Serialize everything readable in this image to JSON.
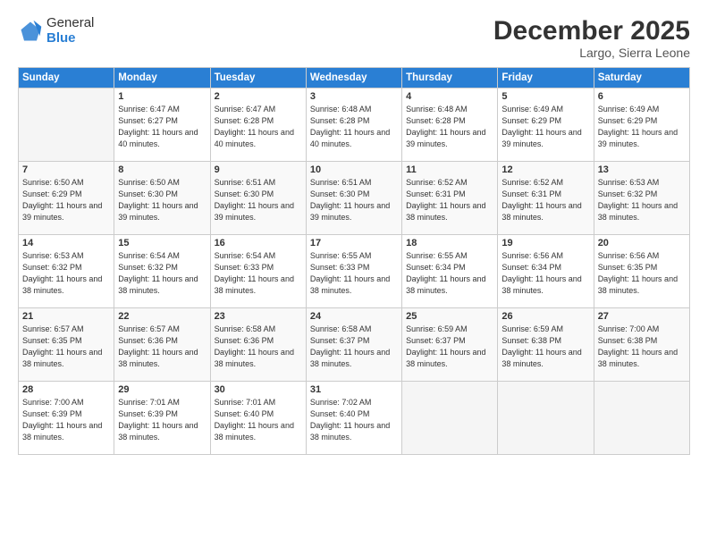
{
  "logo": {
    "general": "General",
    "blue": "Blue"
  },
  "header": {
    "month": "December 2025",
    "location": "Largo, Sierra Leone"
  },
  "weekdays": [
    "Sunday",
    "Monday",
    "Tuesday",
    "Wednesday",
    "Thursday",
    "Friday",
    "Saturday"
  ],
  "weeks": [
    [
      {
        "day": "",
        "empty": true
      },
      {
        "day": "1",
        "sunrise": "6:47 AM",
        "sunset": "6:27 PM",
        "daylight": "11 hours and 40 minutes."
      },
      {
        "day": "2",
        "sunrise": "6:47 AM",
        "sunset": "6:28 PM",
        "daylight": "11 hours and 40 minutes."
      },
      {
        "day": "3",
        "sunrise": "6:48 AM",
        "sunset": "6:28 PM",
        "daylight": "11 hours and 40 minutes."
      },
      {
        "day": "4",
        "sunrise": "6:48 AM",
        "sunset": "6:28 PM",
        "daylight": "11 hours and 39 minutes."
      },
      {
        "day": "5",
        "sunrise": "6:49 AM",
        "sunset": "6:29 PM",
        "daylight": "11 hours and 39 minutes."
      },
      {
        "day": "6",
        "sunrise": "6:49 AM",
        "sunset": "6:29 PM",
        "daylight": "11 hours and 39 minutes."
      }
    ],
    [
      {
        "day": "7",
        "sunrise": "6:50 AM",
        "sunset": "6:29 PM",
        "daylight": "11 hours and 39 minutes."
      },
      {
        "day": "8",
        "sunrise": "6:50 AM",
        "sunset": "6:30 PM",
        "daylight": "11 hours and 39 minutes."
      },
      {
        "day": "9",
        "sunrise": "6:51 AM",
        "sunset": "6:30 PM",
        "daylight": "11 hours and 39 minutes."
      },
      {
        "day": "10",
        "sunrise": "6:51 AM",
        "sunset": "6:30 PM",
        "daylight": "11 hours and 39 minutes."
      },
      {
        "day": "11",
        "sunrise": "6:52 AM",
        "sunset": "6:31 PM",
        "daylight": "11 hours and 38 minutes."
      },
      {
        "day": "12",
        "sunrise": "6:52 AM",
        "sunset": "6:31 PM",
        "daylight": "11 hours and 38 minutes."
      },
      {
        "day": "13",
        "sunrise": "6:53 AM",
        "sunset": "6:32 PM",
        "daylight": "11 hours and 38 minutes."
      }
    ],
    [
      {
        "day": "14",
        "sunrise": "6:53 AM",
        "sunset": "6:32 PM",
        "daylight": "11 hours and 38 minutes."
      },
      {
        "day": "15",
        "sunrise": "6:54 AM",
        "sunset": "6:32 PM",
        "daylight": "11 hours and 38 minutes."
      },
      {
        "day": "16",
        "sunrise": "6:54 AM",
        "sunset": "6:33 PM",
        "daylight": "11 hours and 38 minutes."
      },
      {
        "day": "17",
        "sunrise": "6:55 AM",
        "sunset": "6:33 PM",
        "daylight": "11 hours and 38 minutes."
      },
      {
        "day": "18",
        "sunrise": "6:55 AM",
        "sunset": "6:34 PM",
        "daylight": "11 hours and 38 minutes."
      },
      {
        "day": "19",
        "sunrise": "6:56 AM",
        "sunset": "6:34 PM",
        "daylight": "11 hours and 38 minutes."
      },
      {
        "day": "20",
        "sunrise": "6:56 AM",
        "sunset": "6:35 PM",
        "daylight": "11 hours and 38 minutes."
      }
    ],
    [
      {
        "day": "21",
        "sunrise": "6:57 AM",
        "sunset": "6:35 PM",
        "daylight": "11 hours and 38 minutes."
      },
      {
        "day": "22",
        "sunrise": "6:57 AM",
        "sunset": "6:36 PM",
        "daylight": "11 hours and 38 minutes."
      },
      {
        "day": "23",
        "sunrise": "6:58 AM",
        "sunset": "6:36 PM",
        "daylight": "11 hours and 38 minutes."
      },
      {
        "day": "24",
        "sunrise": "6:58 AM",
        "sunset": "6:37 PM",
        "daylight": "11 hours and 38 minutes."
      },
      {
        "day": "25",
        "sunrise": "6:59 AM",
        "sunset": "6:37 PM",
        "daylight": "11 hours and 38 minutes."
      },
      {
        "day": "26",
        "sunrise": "6:59 AM",
        "sunset": "6:38 PM",
        "daylight": "11 hours and 38 minutes."
      },
      {
        "day": "27",
        "sunrise": "7:00 AM",
        "sunset": "6:38 PM",
        "daylight": "11 hours and 38 minutes."
      }
    ],
    [
      {
        "day": "28",
        "sunrise": "7:00 AM",
        "sunset": "6:39 PM",
        "daylight": "11 hours and 38 minutes."
      },
      {
        "day": "29",
        "sunrise": "7:01 AM",
        "sunset": "6:39 PM",
        "daylight": "11 hours and 38 minutes."
      },
      {
        "day": "30",
        "sunrise": "7:01 AM",
        "sunset": "6:40 PM",
        "daylight": "11 hours and 38 minutes."
      },
      {
        "day": "31",
        "sunrise": "7:02 AM",
        "sunset": "6:40 PM",
        "daylight": "11 hours and 38 minutes."
      },
      {
        "day": "",
        "empty": true
      },
      {
        "day": "",
        "empty": true
      },
      {
        "day": "",
        "empty": true
      }
    ]
  ],
  "labels": {
    "sunrise": "Sunrise:",
    "sunset": "Sunset:",
    "daylight": "Daylight:"
  }
}
